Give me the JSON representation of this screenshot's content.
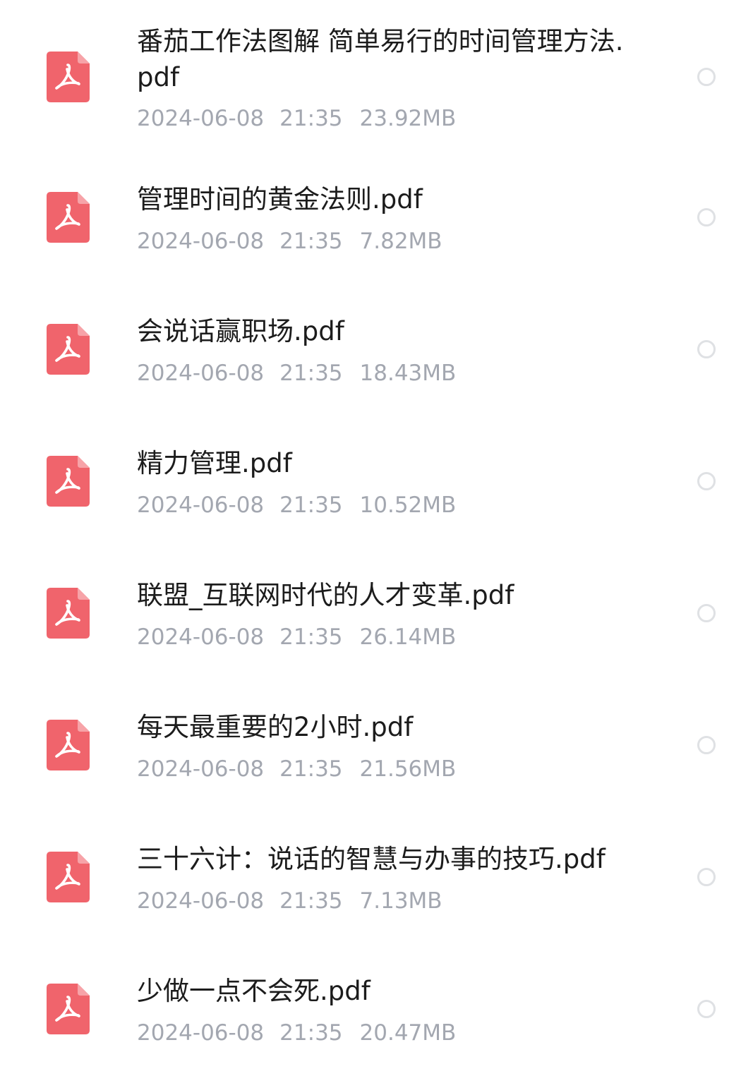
{
  "files": [
    {
      "name": "番茄工作法图解  简单易行的时间管理方法.pdf",
      "date": "2024-06-08",
      "time": "21:35",
      "size": "23.92MB",
      "icon": "pdf-file-icon",
      "selected": false
    },
    {
      "name": "管理时间的黄金法则.pdf",
      "date": "2024-06-08",
      "time": "21:35",
      "size": "7.82MB",
      "icon": "pdf-file-icon",
      "selected": false
    },
    {
      "name": "会说话赢职场.pdf",
      "date": "2024-06-08",
      "time": "21:35",
      "size": "18.43MB",
      "icon": "pdf-file-icon",
      "selected": false
    },
    {
      "name": "精力管理.pdf",
      "date": "2024-06-08",
      "time": "21:35",
      "size": "10.52MB",
      "icon": "pdf-file-icon",
      "selected": false
    },
    {
      "name": "联盟_互联网时代的人才变革.pdf",
      "date": "2024-06-08",
      "time": "21:35",
      "size": "26.14MB",
      "icon": "pdf-file-icon",
      "selected": false
    },
    {
      "name": "每天最重要的2小时.pdf",
      "date": "2024-06-08",
      "time": "21:35",
      "size": "21.56MB",
      "icon": "pdf-file-icon",
      "selected": false
    },
    {
      "name": "三十六计：说话的智慧与办事的技巧.pdf",
      "date": "2024-06-08",
      "time": "21:35",
      "size": "7.13MB",
      "icon": "pdf-file-icon",
      "selected": false
    },
    {
      "name": "少做一点不会死.pdf",
      "date": "2024-06-08",
      "time": "21:35",
      "size": "20.47MB",
      "icon": "pdf-file-icon",
      "selected": false
    }
  ],
  "colors": {
    "pdf_icon": "#f0646c",
    "name_text": "#1c1c1c",
    "meta_text": "#a3a7b0",
    "radio_border": "#dfe1e4"
  }
}
